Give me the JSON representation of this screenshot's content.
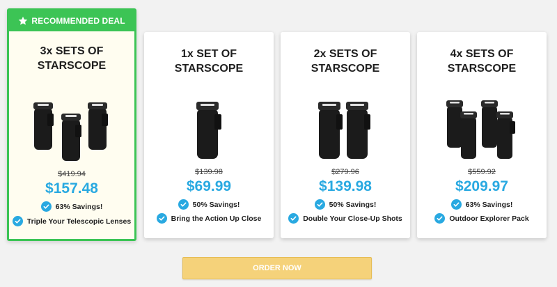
{
  "banner": {
    "label": "RECOMMENDED DEAL",
    "icon": "star-icon"
  },
  "colors": {
    "accent_green": "#3cc455",
    "price_blue": "#29a9e1",
    "button_yellow": "#f5d27a"
  },
  "offers": [
    {
      "title_line1": "3x SETS OF",
      "title_line2": "STARSCOPE",
      "quantity": 3,
      "old_price": "$419.94",
      "price": "$157.48",
      "savings": "63% Savings!",
      "tagline": "Triple Your Telescopic Lenses",
      "recommended": true
    },
    {
      "title_line1": "1x SET OF",
      "title_line2": "STARSCOPE",
      "quantity": 1,
      "old_price": "$139.98",
      "price": "$69.99",
      "savings": "50% Savings!",
      "tagline": "Bring the Action Up Close",
      "recommended": false
    },
    {
      "title_line1": "2x SETS OF",
      "title_line2": "STARSCOPE",
      "quantity": 2,
      "old_price": "$279.96",
      "price": "$139.98",
      "savings": "50% Savings!",
      "tagline": "Double Your Close-Up Shots",
      "recommended": false
    },
    {
      "title_line1": "4x SETS OF",
      "title_line2": "STARSCOPE",
      "quantity": 4,
      "old_price": "$559.92",
      "price": "$209.97",
      "savings": "63% Savings!",
      "tagline": "Outdoor Explorer Pack",
      "recommended": false
    }
  ],
  "order_button": {
    "label": "ORDER NOW"
  }
}
